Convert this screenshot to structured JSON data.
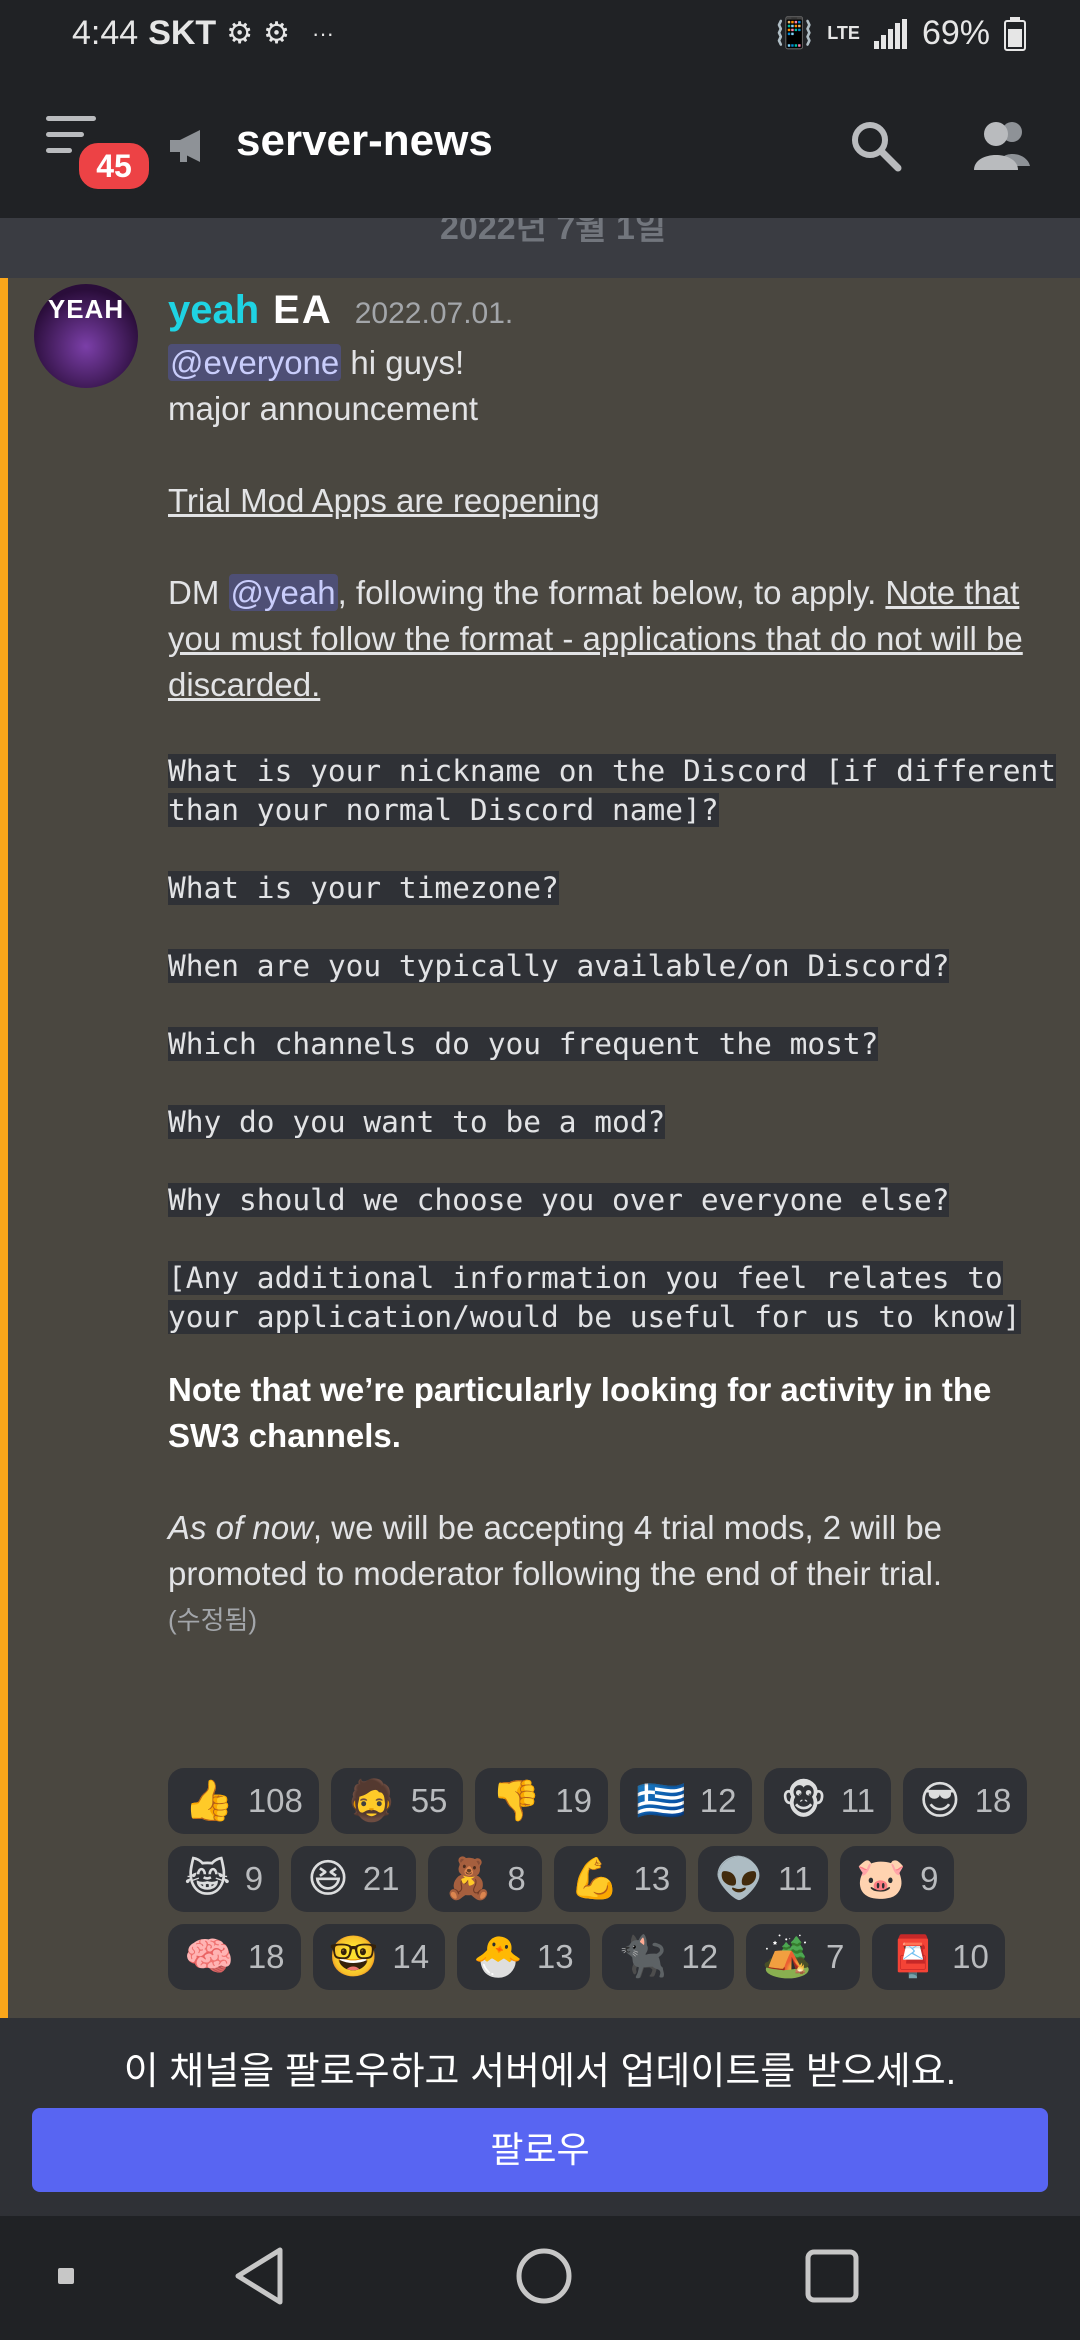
{
  "status": {
    "time": "4:44",
    "carrier": "SKT",
    "dots": "···",
    "battery": "69%"
  },
  "header": {
    "badge": "45",
    "channel_name": "server-news"
  },
  "date_divider": "2022년 7월 1일",
  "message": {
    "author": "yeah",
    "tag": "EA",
    "avatar_text": "YEAH",
    "timestamp": "2022.07.01.",
    "mention_everyone": "@everyone",
    "line1_rest": " hi guys!",
    "line2": "major announcement",
    "heading": "Trial Mod Apps are reopening",
    "dm_prefix": "DM ",
    "mention_yeah": "@yeah",
    "dm_rest": ", following the format below, to apply.  ",
    "note": "Note that you must follow the format - applications that do not will be discarded.",
    "questions": [
      "What is your nickname on the Discord [if different than your normal Discord name]?",
      "What is your timezone?",
      "When are you typically available/on Discord?",
      "Which channels do you frequent the most?",
      "Why do you want to be a mod?",
      "Why should we choose you over everyone else?",
      "[Any additional information you feel relates to your application/would be useful for us to know]"
    ],
    "bold_note": "Note that we’re particularly looking for activity in the SW3 channels.",
    "italic_lead": "As of now",
    "closing": ", we will be accepting 4 trial mods, 2 will be promoted to moderator following the end of their trial.",
    "edited": "(수정됨)"
  },
  "reactions": [
    [
      {
        "emoji": "👍",
        "count": "108"
      },
      {
        "emoji": "🧔",
        "count": "55"
      },
      {
        "emoji": "👎",
        "count": "19"
      },
      {
        "emoji": "🇬🇷",
        "count": "12"
      },
      {
        "emoji": "🐵",
        "count": "11"
      },
      {
        "emoji": "😎",
        "count": "18"
      }
    ],
    [
      {
        "emoji": "😹",
        "count": "9"
      },
      {
        "emoji": "😆",
        "count": "21"
      },
      {
        "emoji": "🧸",
        "count": "8"
      },
      {
        "emoji": "💪",
        "count": "13"
      },
      {
        "emoji": "👽",
        "count": "11"
      },
      {
        "emoji": "🐷",
        "count": "9"
      }
    ],
    [
      {
        "emoji": "🧠",
        "count": "18"
      },
      {
        "emoji": "🤓",
        "count": "14"
      },
      {
        "emoji": "🐣",
        "count": "13"
      },
      {
        "emoji": "🐈‍⬛",
        "count": "12"
      },
      {
        "emoji": "🏕️",
        "count": "7"
      },
      {
        "emoji": "📮",
        "count": "10"
      }
    ]
  ],
  "follow": {
    "prompt": "이 채널을 팔로우하고 서버에서 업데이트를 받으세요.",
    "button": "팔로우"
  },
  "colors": {
    "blurple": "#5865f2",
    "author": "#1fd3e3",
    "badge": "#ed4245",
    "highlight_bar": "#faa61a"
  }
}
